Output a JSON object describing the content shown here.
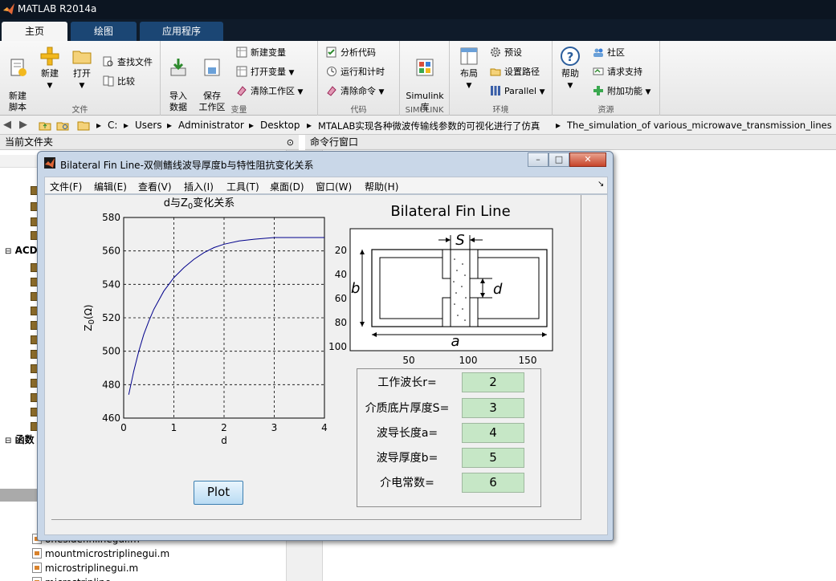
{
  "app": {
    "title": "MATLAB R2014a"
  },
  "tabs": [
    {
      "label": "主页",
      "active": true
    },
    {
      "label": "绘图",
      "active": false
    },
    {
      "label": "应用程序",
      "active": false
    }
  ],
  "ribbon": {
    "file_group": {
      "label": "文件",
      "new_script": "新建\n脚本",
      "new": "新建",
      "open": "打开",
      "find_files": "查找文件",
      "compare": "比较"
    },
    "variable_group": {
      "label": "变量",
      "import_data": "导入\n数据",
      "save_workspace": "保存\n工作区",
      "new_variable": "新建变量",
      "open_variable": "打开变量",
      "clear_workspace": "清除工作区"
    },
    "code_group": {
      "label": "代码",
      "analyze_code": "分析代码",
      "run_and_time": "运行和计时",
      "clear_commands": "清除命令"
    },
    "simulink_group": {
      "label": "SIMULINK",
      "simulink_library": "Simulink\n库"
    },
    "environment_group": {
      "label": "环境",
      "layout": "布局",
      "preferences": "预设",
      "set_path": "设置路径",
      "parallel": "Parallel"
    },
    "resources_group": {
      "label": "资源",
      "help": "帮助",
      "community": "社区",
      "request_support": "请求支持",
      "add_ons": "附加功能"
    }
  },
  "address": {
    "crumbs": [
      "C:",
      "Users",
      "Administrator",
      "Desktop",
      "MTALAB实现各种微波传输线参数的可视化进行了仿真",
      "The_simulation_of various_microwave_transmission_lines"
    ]
  },
  "panels": {
    "current_folder": "当前文件夹",
    "command_window": "命令行窗口"
  },
  "tree": {
    "acd_label": "ACD",
    "func_label": "函数",
    "files": [
      "onesidefinlinegui.m",
      "mountmicrostriplinegui.m",
      "microstriplinegui.m",
      "microstripline"
    ]
  },
  "figure": {
    "title": "Bilateral Fin Line-双侧鳍线波导厚度b与特性阻抗变化关系",
    "controls": {
      "minimize": "–",
      "maximize": "□",
      "close": "✕"
    },
    "menus": [
      "文件(F)",
      "编辑(E)",
      "查看(V)",
      "插入(I)",
      "工具(T)",
      "桌面(D)",
      "窗口(W)",
      "帮助(H)"
    ],
    "plot_button": "Plot",
    "params": [
      {
        "label": "工作波长r=",
        "value": "2"
      },
      {
        "label": "介质底片厚度S=",
        "value": "3"
      },
      {
        "label": "波导长度a=",
        "value": "4"
      },
      {
        "label": "波导厚度b=",
        "value": "5"
      },
      {
        "label": "介电常数=",
        "value": "6"
      }
    ],
    "diagram": {
      "title": "Bilateral Fin Line",
      "labels": {
        "s": "S",
        "d": "d",
        "b": "b",
        "a": "a"
      },
      "xticks": [
        "50",
        "100",
        "150"
      ],
      "yticks": [
        "20",
        "40",
        "60",
        "80",
        "100"
      ]
    }
  },
  "chart_data": {
    "type": "line",
    "title": "d与Z0变化关系",
    "xlabel": "d",
    "ylabel": "Z0(Ω)",
    "xlim": [
      0,
      4
    ],
    "ylim": [
      460,
      580
    ],
    "xticks": [
      "0",
      "1",
      "2",
      "3",
      "4"
    ],
    "yticks": [
      "460",
      "480",
      "500",
      "520",
      "540",
      "560",
      "580"
    ],
    "grid": true,
    "series": [
      {
        "color": "#00008b",
        "x": [
          0.1,
          0.2,
          0.3,
          0.4,
          0.5,
          0.6,
          0.8,
          1.0,
          1.2,
          1.4,
          1.6,
          1.8,
          2.0,
          2.3,
          2.6,
          3.0,
          3.4,
          3.8,
          4.0
        ],
        "y": [
          474,
          488,
          500,
          510,
          518,
          525,
          536,
          544,
          550,
          555,
          559,
          562,
          564,
          566,
          567,
          568,
          568,
          568,
          568
        ]
      }
    ]
  }
}
